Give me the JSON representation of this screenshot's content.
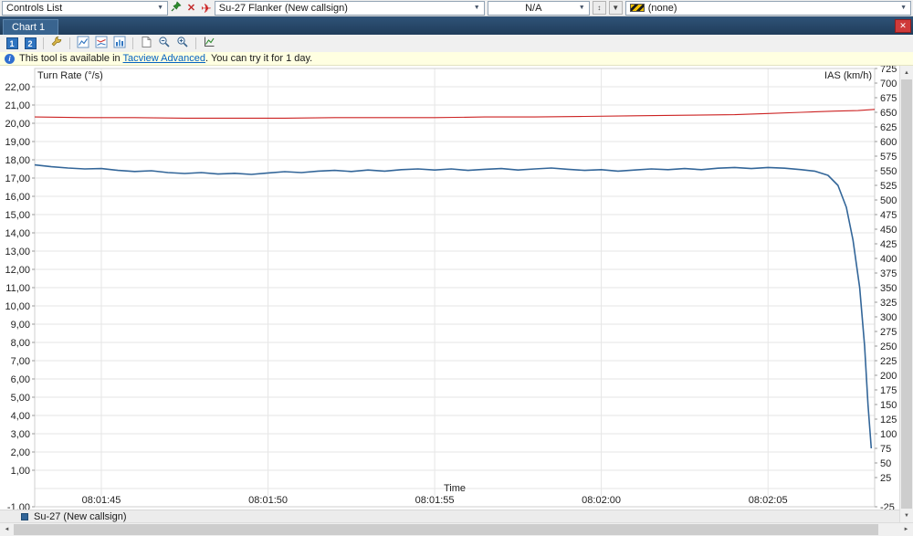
{
  "top_bar": {
    "controls_combo": "Controls List",
    "aircraft_combo": "Su-27 Flanker (New callsign)",
    "secondary_combo": "N/A",
    "none_combo": "(none)"
  },
  "tab_bar": {
    "title": "Chart 1"
  },
  "toolbar": {
    "view1": "1",
    "view2": "2"
  },
  "info_bar": {
    "prefix": "This tool is available in ",
    "link": "Tacview Advanced",
    "suffix": ". You can try it for 1 day."
  },
  "legend": {
    "label": "Su-27 (New callsign)",
    "color": "#336699"
  },
  "chart_data": {
    "type": "line",
    "title": "Chart 1",
    "x_label": "Time",
    "x_range_seconds": [
      0,
      25.2
    ],
    "x_start_time": "08:01:43",
    "x_ticks": [
      {
        "t": 2,
        "label": "08:01:45"
      },
      {
        "t": 7,
        "label": "08:01:50"
      },
      {
        "t": 12,
        "label": "08:01:55"
      },
      {
        "t": 17,
        "label": "08:02:00"
      },
      {
        "t": 22,
        "label": "08:02:05"
      }
    ],
    "left_axis": {
      "title": "Turn Rate (°/s)",
      "color": "#336699",
      "min": -1,
      "max": 23,
      "ticks": [
        22,
        21,
        20,
        19,
        18,
        17,
        16,
        15,
        14,
        13,
        12,
        11,
        10,
        9,
        8,
        7,
        6,
        5,
        4,
        3,
        2,
        1,
        -1
      ],
      "tick_labels": [
        "22,00",
        "21,00",
        "20,00",
        "19,00",
        "18,00",
        "17,00",
        "16,00",
        "15,00",
        "14,00",
        "13,00",
        "12,00",
        "11,00",
        "10,00",
        "9,00",
        "8,00",
        "7,00",
        "6,00",
        "5,00",
        "4,00",
        "3,00",
        "2,00",
        "1,00",
        "-1,00"
      ],
      "grid_values": [
        22,
        21,
        20,
        19,
        18,
        17,
        16,
        15,
        14,
        13,
        12,
        11,
        10,
        9,
        8,
        7,
        6,
        5,
        4,
        3,
        2,
        1,
        0
      ]
    },
    "right_axis": {
      "title": "IAS (km/h)",
      "color": "#cc2222",
      "min": -25,
      "max": 725,
      "ticks": [
        725,
        700,
        675,
        650,
        625,
        600,
        575,
        550,
        525,
        500,
        475,
        450,
        425,
        400,
        375,
        350,
        325,
        300,
        275,
        250,
        225,
        200,
        175,
        150,
        125,
        100,
        75,
        50,
        25,
        -25
      ],
      "tick_labels": [
        "725",
        "700",
        "675",
        "650",
        "625",
        "600",
        "575",
        "550",
        "525",
        "500",
        "475",
        "450",
        "425",
        "400",
        "375",
        "350",
        "325",
        "300",
        "275",
        "250",
        "225",
        "200",
        "175",
        "150",
        "125",
        "100",
        "75",
        "50",
        "25",
        "-25"
      ]
    },
    "series": [
      {
        "name": "turn-rate",
        "legend": "Su-27 (New callsign)",
        "axis": "left",
        "color": "#336699",
        "width": 1.6,
        "points": [
          [
            0,
            17.72
          ],
          [
            0.5,
            17.62
          ],
          [
            1,
            17.55
          ],
          [
            1.5,
            17.5
          ],
          [
            2,
            17.52
          ],
          [
            2.5,
            17.42
          ],
          [
            3,
            17.36
          ],
          [
            3.5,
            17.4
          ],
          [
            4,
            17.3
          ],
          [
            4.5,
            17.25
          ],
          [
            5,
            17.3
          ],
          [
            5.5,
            17.22
          ],
          [
            6,
            17.26
          ],
          [
            6.5,
            17.2
          ],
          [
            7,
            17.28
          ],
          [
            7.5,
            17.35
          ],
          [
            8,
            17.3
          ],
          [
            8.5,
            17.38
          ],
          [
            9,
            17.42
          ],
          [
            9.5,
            17.36
          ],
          [
            10,
            17.44
          ],
          [
            10.5,
            17.38
          ],
          [
            11,
            17.46
          ],
          [
            11.5,
            17.5
          ],
          [
            12,
            17.44
          ],
          [
            12.5,
            17.5
          ],
          [
            13,
            17.42
          ],
          [
            13.5,
            17.48
          ],
          [
            14,
            17.52
          ],
          [
            14.5,
            17.44
          ],
          [
            15,
            17.5
          ],
          [
            15.5,
            17.55
          ],
          [
            16,
            17.48
          ],
          [
            16.5,
            17.42
          ],
          [
            17,
            17.46
          ],
          [
            17.5,
            17.38
          ],
          [
            18,
            17.44
          ],
          [
            18.5,
            17.5
          ],
          [
            19,
            17.46
          ],
          [
            19.5,
            17.52
          ],
          [
            20,
            17.46
          ],
          [
            20.5,
            17.54
          ],
          [
            21,
            17.58
          ],
          [
            21.5,
            17.52
          ],
          [
            22,
            17.58
          ],
          [
            22.5,
            17.54
          ],
          [
            23,
            17.46
          ],
          [
            23.4,
            17.38
          ],
          [
            23.8,
            17.15
          ],
          [
            24.1,
            16.6
          ],
          [
            24.35,
            15.4
          ],
          [
            24.55,
            13.6
          ],
          [
            24.75,
            11.0
          ],
          [
            24.9,
            7.8
          ],
          [
            25.0,
            4.6
          ],
          [
            25.1,
            2.2
          ]
        ]
      },
      {
        "name": "ias",
        "legend": "Su-27 (New callsign)",
        "axis": "right",
        "color": "#cc2222",
        "width": 1.1,
        "points": [
          [
            0,
            642
          ],
          [
            1.5,
            641
          ],
          [
            3,
            641
          ],
          [
            4.5,
            640
          ],
          [
            6,
            640
          ],
          [
            7.5,
            640
          ],
          [
            9,
            641
          ],
          [
            10.5,
            641
          ],
          [
            12,
            641
          ],
          [
            13.5,
            642
          ],
          [
            15,
            642
          ],
          [
            16.5,
            643
          ],
          [
            18,
            644
          ],
          [
            19.5,
            645
          ],
          [
            21,
            646
          ],
          [
            22,
            648
          ],
          [
            23,
            650
          ],
          [
            24,
            652
          ],
          [
            24.7,
            653
          ],
          [
            25.2,
            655
          ]
        ]
      }
    ]
  }
}
